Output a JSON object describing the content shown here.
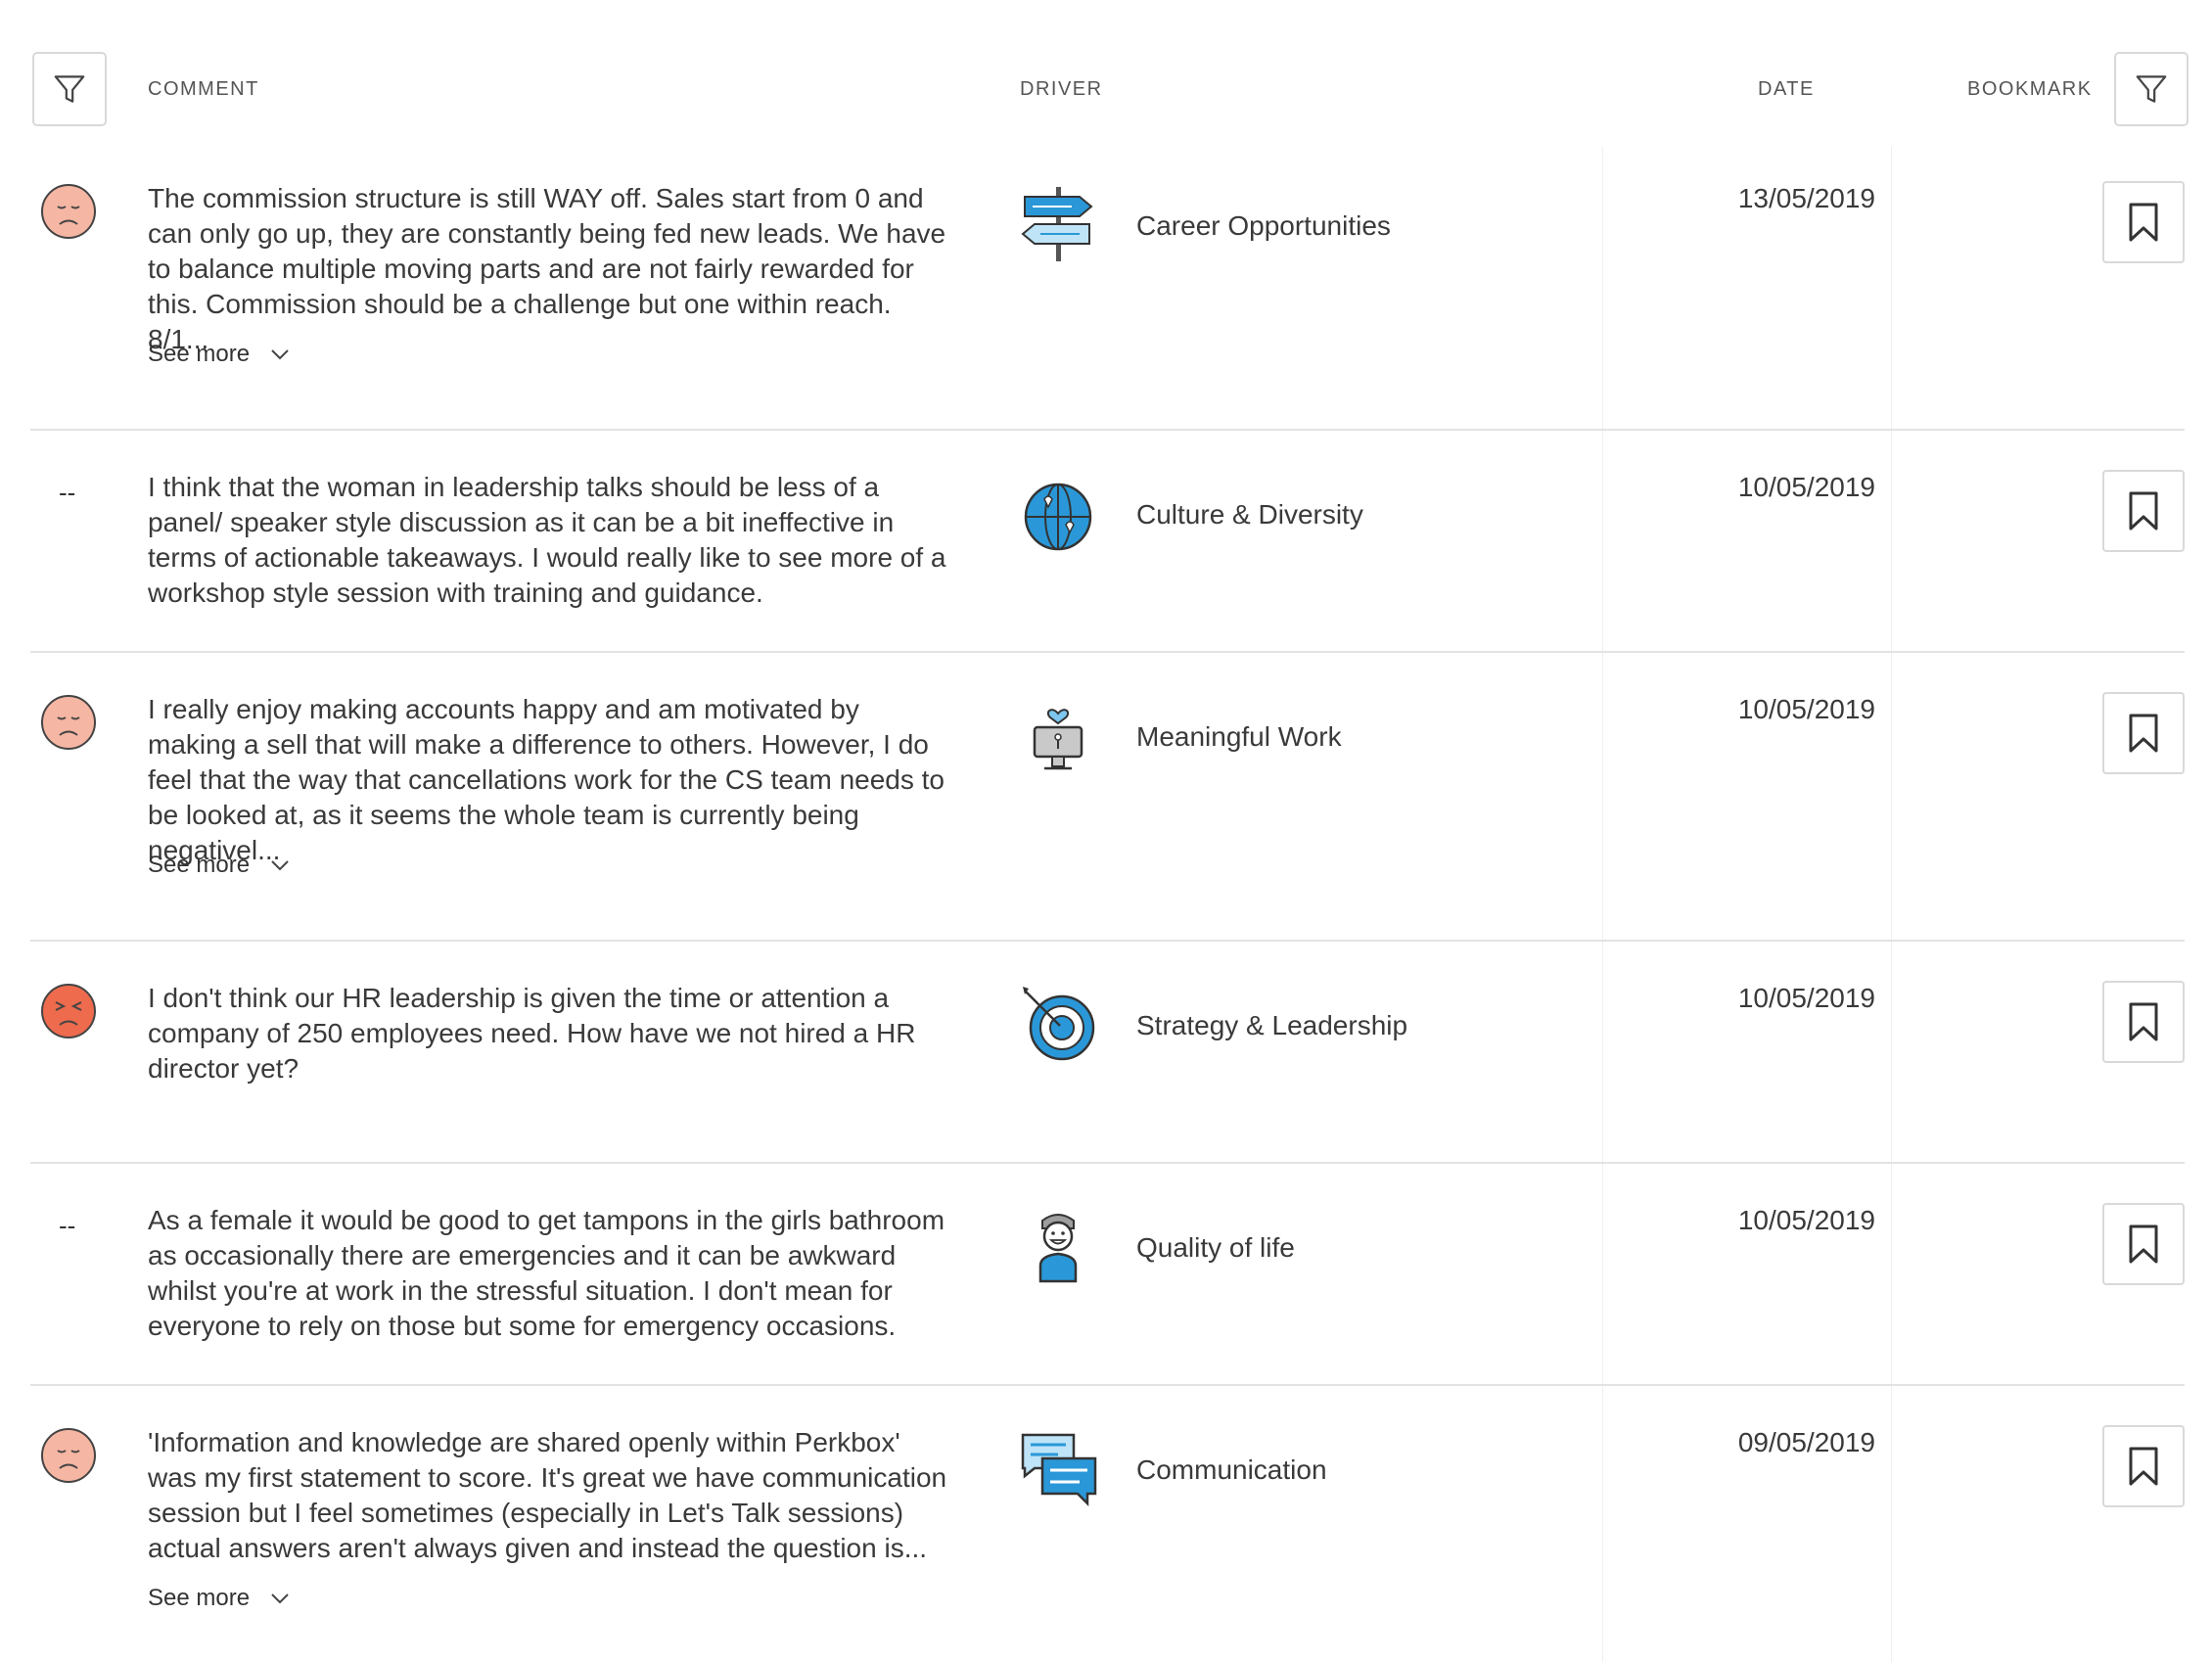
{
  "header": {
    "comment": "COMMENT",
    "driver": "DRIVER",
    "date": "DATE",
    "bookmark": "BOOKMARK"
  },
  "see_more": "See more",
  "colors": {
    "sad": "#f5b6a3",
    "angry": "#ee6b4d",
    "icon_blue": "#2a98d8",
    "border": "#d9d9d9"
  },
  "rows": [
    {
      "sentiment": "sad-face-icon",
      "comment": "The commission structure is still WAY off. Sales start from 0 and can only go up, they are constantly being fed new leads. We have to balance multiple moving parts and are not fairly rewarded for this. Commission should be a challenge but one within reach. 8/1...",
      "see_more": true,
      "driver_icon": "signpost-icon",
      "driver": "Career Opportunities",
      "date": "13/05/2019"
    },
    {
      "sentiment": "--",
      "comment": "I think that the woman in leadership talks should be less of a panel/ speaker style discussion as it can be a bit ineffective in terms of actionable takeaways. I would really like to see more of a workshop style session with training and guidance.",
      "see_more": false,
      "driver_icon": "globe-icon",
      "driver": "Culture & Diversity",
      "date": "10/05/2019"
    },
    {
      "sentiment": "sad-face-icon",
      "comment": "I really enjoy making accounts happy and am motivated by making a sell that will make a difference to others. However, I do feel that the way that cancellations work for the CS team needs to be looked at, as it seems the whole team is currently being negativel...",
      "see_more": true,
      "driver_icon": "computer-heart-icon",
      "driver": "Meaningful Work",
      "date": "10/05/2019"
    },
    {
      "sentiment": "angry-face-icon",
      "comment": "I don't think our HR leadership is given the time or attention a company of 250 employees need. How have we not hired a HR director yet?",
      "see_more": false,
      "driver_icon": "target-icon",
      "driver": "Strategy & Leadership",
      "date": "10/05/2019"
    },
    {
      "sentiment": "--",
      "comment": "As a female it would be good to get tampons in the girls bathroom as occasionally there are emergencies and it can be awkward whilst you're at work in the stressful situation. I don't mean for everyone to rely on those but some for emergency occasions.",
      "see_more": false,
      "driver_icon": "happy-person-icon",
      "driver": "Quality of life",
      "date": "10/05/2019"
    },
    {
      "sentiment": "sad-face-icon",
      "comment": "'Information and knowledge are shared openly within Perkbox' was my first statement to score. It's great we have communication session but I feel sometimes (especially in Let's Talk sessions) actual answers aren't always given and instead the question is...",
      "see_more": true,
      "driver_icon": "chat-bubbles-icon",
      "driver": "Communication",
      "date": "09/05/2019"
    }
  ]
}
